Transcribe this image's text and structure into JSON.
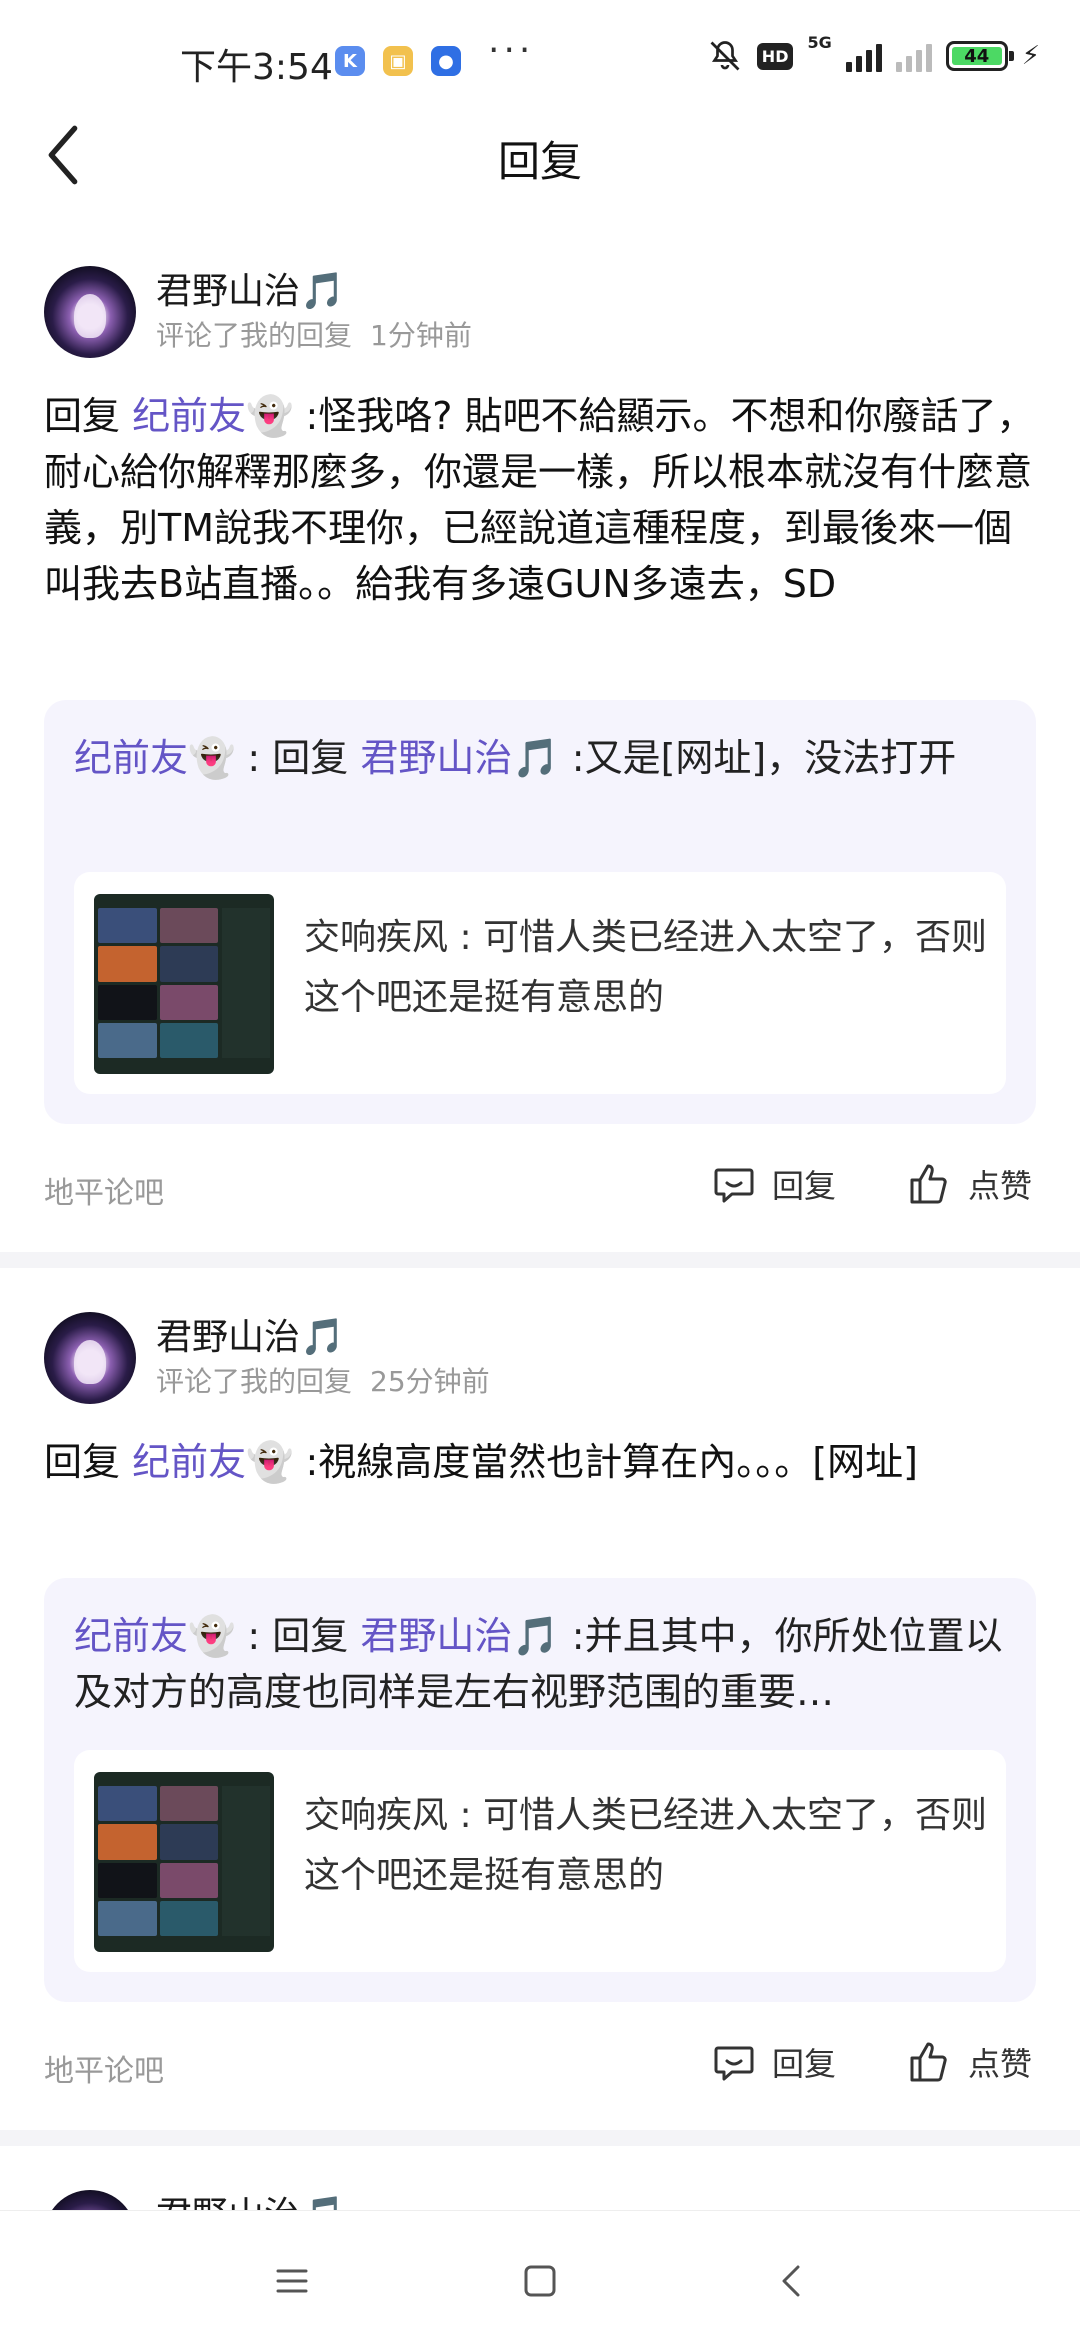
{
  "status_bar": {
    "time": "下午3:54",
    "app_icons": [
      {
        "name": "k-app-icon",
        "glyph": "K",
        "color": "#5b8def"
      },
      {
        "name": "square-app-icon",
        "glyph": "▣",
        "color": "#f2c14e"
      },
      {
        "name": "circle-app-icon",
        "glyph": "●",
        "color": "#2f6fe4"
      }
    ],
    "more": "···",
    "hd": "HD",
    "network": "5G",
    "battery_level": "44",
    "battery_percent": 44
  },
  "header": {
    "title": "回复"
  },
  "items": [
    {
      "username": "君野山治🎵",
      "action": "评论了我的回复",
      "time": "1分钟前",
      "reply_prefix": "回复 ",
      "reply_mention": "纪前友👻",
      "reply_body": " :怪我咯? 貼吧不給顯示。不想和你廢話了，耐心給你解釋那麼多，你還是一樣，所以根本就沒有什麼意義，別TM說我不理你，已經說道這種程度，到最後來一個叫我去B站直播。。給我有多遠GUN多遠去，SD",
      "quote_author": "纪前友👻",
      "quote_mid": " : 回复 ",
      "quote_mention": "君野山治🎵",
      "quote_body": " :又是[网址]，没法打开",
      "card_text": "交响疾风 : 可惜人类已经进入太空了，否则这个吧还是挺有意思的",
      "forum": "地平论吧",
      "reply_label": "回复",
      "like_label": "点赞"
    },
    {
      "username": "君野山治🎵",
      "action": "评论了我的回复",
      "time": "25分钟前",
      "reply_prefix": "回复 ",
      "reply_mention": "纪前友👻",
      "reply_body": " :視線高度當然也計算在內。。。[网址]",
      "quote_author": "纪前友👻",
      "quote_mid": " : 回复 ",
      "quote_mention": "君野山治🎵",
      "quote_body": " :并且其中，你所处位置以及对方的高度也同样是左右视野范围的重要…",
      "card_text": "交响疾风 : 可惜人类已经进入太空了，否则这个吧还是挺有意思的",
      "forum": "地平论吧",
      "reply_label": "回复",
      "like_label": "点赞"
    }
  ],
  "partial_item": {
    "username": "君野山治🎵"
  },
  "colors": {
    "accent": "#6455c6",
    "quote_bg": "#f5f4fd",
    "muted": "#999999"
  },
  "nav": {
    "menu_icon": "menu-icon",
    "home_icon": "home-square-icon",
    "back_icon": "back-triangle-icon"
  }
}
